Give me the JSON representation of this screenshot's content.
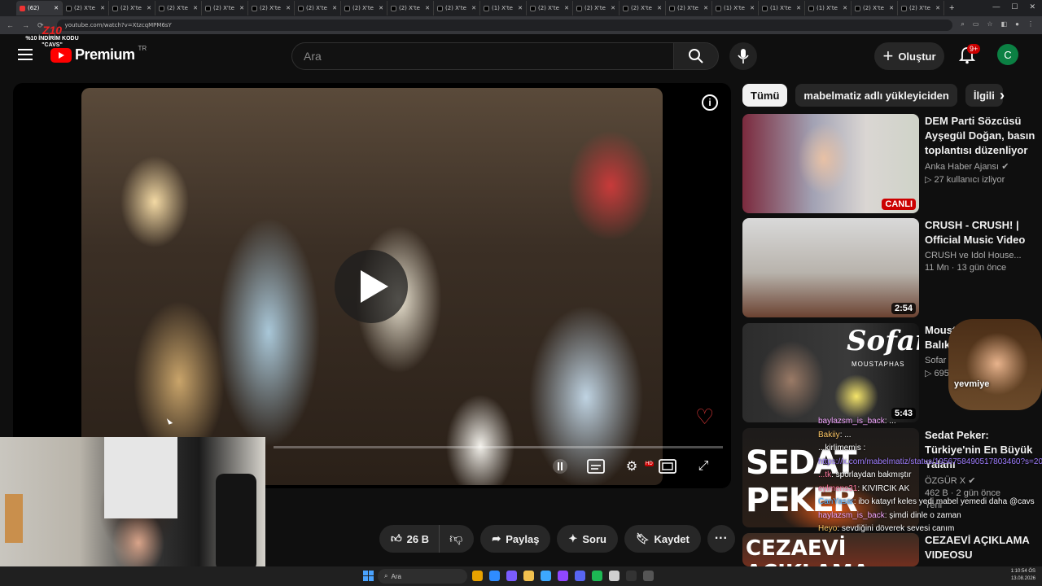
{
  "browser": {
    "tabs": [
      {
        "label": "(62)",
        "icon": "youtube-icon",
        "active": true
      },
      {
        "label": "(2) X'te"
      },
      {
        "label": "(2) X'te"
      },
      {
        "label": "(2) X'te"
      },
      {
        "label": "(2) X'te"
      },
      {
        "label": "(2) X'te"
      },
      {
        "label": "(2) X'te"
      },
      {
        "label": "(2) X'te"
      },
      {
        "label": "(2) X'te"
      },
      {
        "label": "(2) X'te"
      },
      {
        "label": "(1) X'te"
      },
      {
        "label": "(2) X'te"
      },
      {
        "label": "(2) X'te"
      },
      {
        "label": "(2) X'te"
      },
      {
        "label": "(2) X'te"
      },
      {
        "label": "(1) X'te"
      },
      {
        "label": "(1) X'te"
      },
      {
        "label": "(1) X'te"
      },
      {
        "label": "(2) X'te"
      },
      {
        "label": "(2) X'te"
      }
    ],
    "url": "youtube.com/watch?v=XtzcqMPM6sY"
  },
  "overlay": {
    "logo_big": "Z10",
    "promo_line1": "%10 İNDİRİM KODU",
    "promo_line2": "\"CAVS\""
  },
  "header": {
    "brand": "Premium",
    "country": "TR",
    "search_placeholder": "Ara",
    "create_label": "Oluştur",
    "notif_badge": "9+",
    "avatar_letter": "C"
  },
  "actions": {
    "like_count": "26 B",
    "share": "Paylaş",
    "ask": "Soru",
    "save": "Kaydet"
  },
  "chips": [
    "Tümü",
    "mabelmatiz adlı yükleyiciden",
    "İlgili"
  ],
  "recommendations": [
    {
      "title": "DEM Parti Sözcüsü Ayşegül Doğan, basın toplantısı düzenliyor ...",
      "channel": "Anka Haber Ajansı",
      "meta": "27 kullanıcı izliyor",
      "badge": "CANLI",
      "verified": true
    },
    {
      "title": "CRUSH - CRUSH! | Official Music Video",
      "channel": "CRUSH ve Idol House...",
      "meta": "11 Mn · 13 gün önce",
      "badge": "2:54",
      "verified": true
    },
    {
      "title": "Moustapha... Kara Balık |... İzmir",
      "channel": "Sofar G...",
      "meta": "695 ...",
      "badge": "5:43",
      "thumb_text": "Sofar",
      "thumb_sub": "MOUSTAPHAS"
    },
    {
      "title": "Sedat Peker: Türkiye'nin En Büyük Yalanı",
      "channel": "ÖZGÜR X",
      "meta": "462 B · 2 gün önce",
      "badge": "Yeni",
      "thumb_text": "SEDAT PEKER",
      "verified": true
    },
    {
      "title": "CEZAEVİ AÇIKLAMA VIDEOSU",
      "channel": "",
      "meta": "",
      "thumb_text": "CEZAEVİ AÇIKLAMA"
    }
  ],
  "chat": [
    {
      "user": "baylazsm_is_back",
      "text": ": ...",
      "cls": "u1"
    },
    {
      "user": "Bakiiy",
      "text": ": ...",
      "cls": "u5"
    },
    {
      "user": "",
      "text": "...kirlimemis :",
      "cls": ""
    },
    {
      "user": "",
      "text": "https://x.com/mabelmatiz/status/1956758490517803460?s=20",
      "cls": "u2"
    },
    {
      "user": "...tk",
      "text": ": sporlaydan bakmıştır",
      "cls": "u3"
    },
    {
      "user": "eylmens31",
      "text": ": KIVIRCIK AK",
      "cls": "u3"
    },
    {
      "user": "CanYasar",
      "text": ": ibo katayıf keles yedi mabel yemedi daha @cavs",
      "cls": "u4"
    },
    {
      "user": "haylazsm_is_back",
      "text": ": şimdi dinle o zaman",
      "cls": "u1"
    },
    {
      "user": "Heyo",
      "text": ": sevdiğini döverek sevesi canım",
      "cls": "u5"
    }
  ],
  "streamer_overlay": {
    "label": "yevmiye"
  },
  "taskbar": {
    "search_placeholder": "Ara",
    "time": "1:10:54 ÖS",
    "date": "13.08.2026"
  }
}
